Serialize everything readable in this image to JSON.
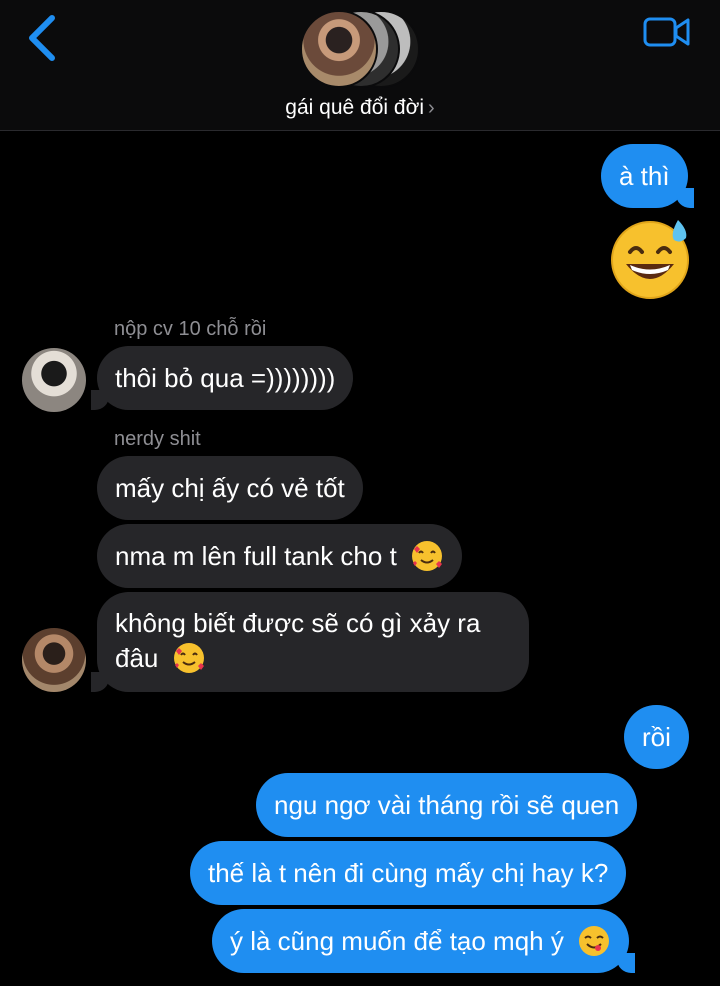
{
  "header": {
    "group_name": "gái quê đổi đời",
    "chevron": "›"
  },
  "icons": {
    "back": "chevron-left-icon",
    "video": "video-camera-icon",
    "accent": "#1f8ef1"
  },
  "messages": {
    "m1": "à thì",
    "m2_emoji": "grinning-face-with-sweat-emoji",
    "sender1": "nộp cv 10 chỗ rồi",
    "m3": "thôi bỏ qua =))))))))",
    "sender2": "nerdy shit",
    "m4": "mấy chị ấy có vẻ tốt",
    "m5": "nma m lên full tank cho t",
    "m6": "không biết được sẽ có gì xảy ra đâu",
    "m7": "rồi",
    "m8": "ngu ngơ vài tháng rồi sẽ quen",
    "m9": "thế là t nên đi cùng mấy chị hay k?",
    "m10": "ý là cũng muốn để tạo mqh ý"
  },
  "colors": {
    "outgoing": "#1f8ef1",
    "incoming": "#262629",
    "background": "#000000"
  }
}
